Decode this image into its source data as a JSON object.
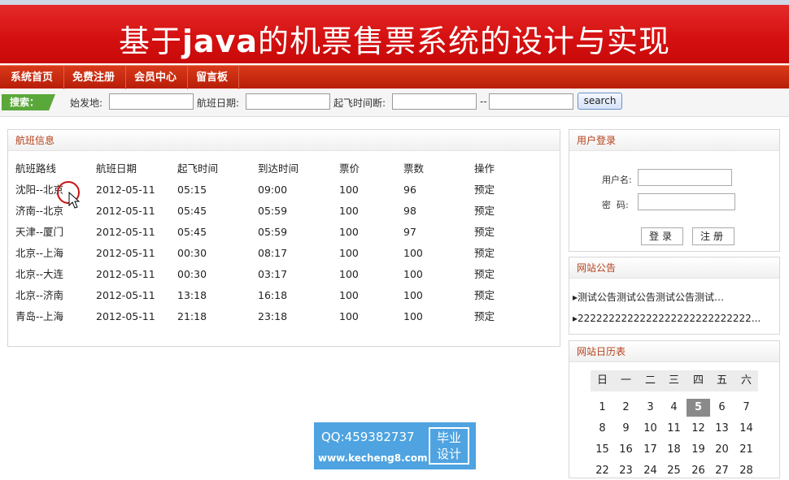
{
  "banner": {
    "title_prefix": "基于",
    "title_keyword": "java",
    "title_suffix": "的机票售票系统的设计与实现"
  },
  "nav": {
    "items": [
      {
        "label": "系统首页"
      },
      {
        "label": "免费注册"
      },
      {
        "label": "会员中心"
      },
      {
        "label": "留言板"
      }
    ]
  },
  "search": {
    "tag": "搜索：",
    "origin_label": "始发地:",
    "date_label": "航班日期:",
    "time_range_label": "起飞时间断:",
    "range_separator": "--",
    "button": "search"
  },
  "flights": {
    "title": "航班信息",
    "headers": [
      "航班路线",
      "航班日期",
      "起飞时间",
      "到达时间",
      "票价",
      "票数",
      "操作"
    ],
    "rows": [
      [
        "沈阳--北京",
        "2012-05-11",
        "05:15",
        "09:00",
        "100",
        "96",
        "预定"
      ],
      [
        "济南--北京",
        "2012-05-11",
        "05:45",
        "05:59",
        "100",
        "98",
        "预定"
      ],
      [
        "天津--厦门",
        "2012-05-11",
        "05:45",
        "05:59",
        "100",
        "97",
        "预定"
      ],
      [
        "北京--上海",
        "2012-05-11",
        "00:30",
        "08:17",
        "100",
        "100",
        "预定"
      ],
      [
        "北京--大连",
        "2012-05-11",
        "00:30",
        "03:17",
        "100",
        "100",
        "预定"
      ],
      [
        "北京--济南",
        "2012-05-11",
        "13:18",
        "16:18",
        "100",
        "100",
        "预定"
      ],
      [
        "青岛--上海",
        "2012-05-11",
        "21:18",
        "23:18",
        "100",
        "100",
        "预定"
      ]
    ]
  },
  "login": {
    "title": "用户登录",
    "username_label": "用户名:",
    "password_label": "密  码:",
    "login_button": "登录",
    "register_button": "注册"
  },
  "announcements": {
    "title": "网站公告",
    "items": [
      "测试公告测试公告测试公告测试…",
      "2222222222222222222222222222..."
    ]
  },
  "calendar": {
    "title": "网站日历表",
    "weekdays": [
      "日",
      "一",
      "二",
      "三",
      "四",
      "五",
      "六"
    ],
    "weeks": [
      [
        "",
        "",
        "1",
        "2",
        "3",
        "4",
        "5",
        "6",
        "7"
      ],
      [
        "8",
        "9",
        "10",
        "11",
        "12",
        "13",
        "14"
      ],
      [
        "15",
        "16",
        "17",
        "18",
        "19",
        "20",
        "21"
      ],
      [
        "22",
        "23",
        "24",
        "25",
        "26",
        "27",
        "28"
      ]
    ],
    "today": "5"
  },
  "watermark": {
    "qq": "QQ:459382737",
    "url": "www.kecheng8.com",
    "badge_line1": "毕业",
    "badge_line2": "设计"
  },
  "colors": {
    "banner_red": "#d40f0f",
    "nav_red": "#c22a10",
    "accent_brown": "#b5401a",
    "search_green": "#5aa83a"
  }
}
